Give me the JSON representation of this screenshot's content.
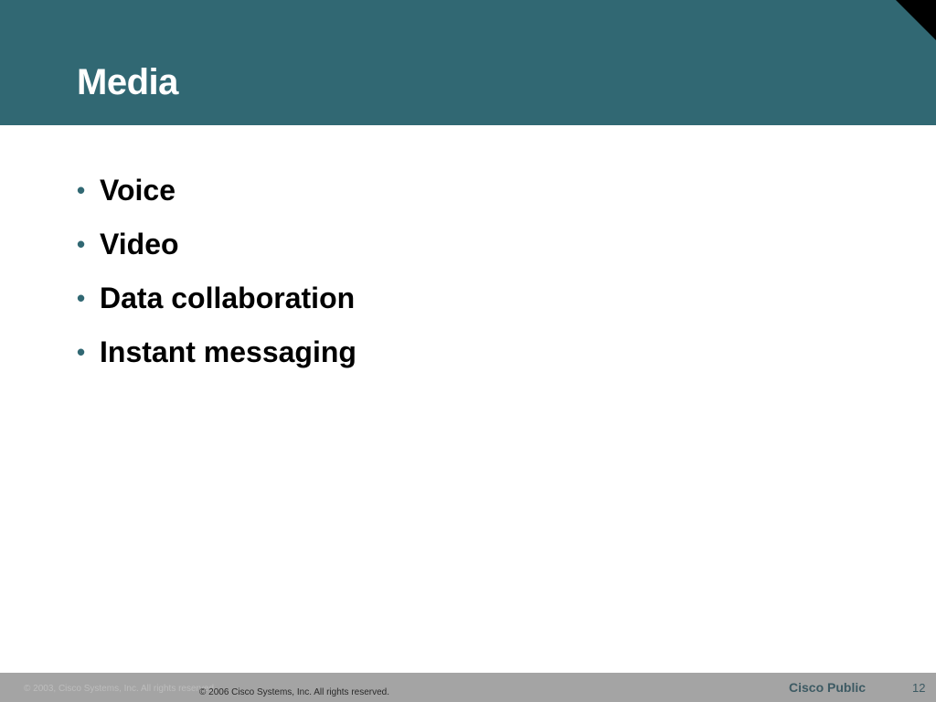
{
  "slide": {
    "title": "Media",
    "bullets": [
      {
        "marker": "•",
        "text": "Voice"
      },
      {
        "marker": "•",
        "text": "Video"
      },
      {
        "marker": "•",
        "text": "Data collaboration"
      },
      {
        "marker": "•",
        "text": "Instant messaging"
      }
    ]
  },
  "footer": {
    "ghost_copyright": "© 2003, Cisco Systems, Inc. All rights reserved.",
    "copyright": "© 2006 Cisco Systems, Inc. All rights reserved.",
    "classification": "Cisco Public",
    "page_number": "12"
  },
  "colors": {
    "header_band": "#316873",
    "footer_band": "#a4a4a4",
    "corner_triangle": "#000000",
    "bullet_marker": "#316873"
  }
}
